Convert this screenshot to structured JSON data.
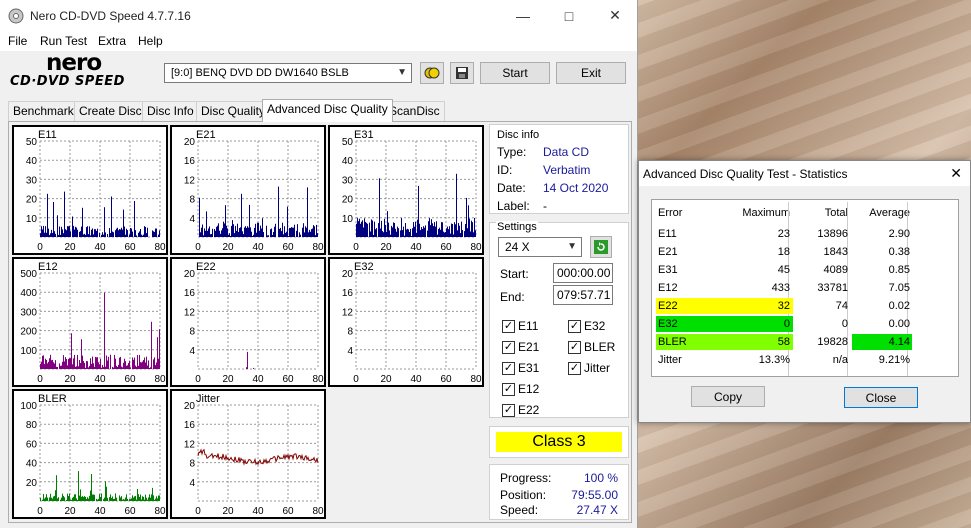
{
  "window": {
    "title": "Nero CD-DVD Speed 4.7.7.16"
  },
  "menu": [
    "File",
    "Run Test",
    "Extra",
    "Help"
  ],
  "logo": {
    "top": "nero",
    "bottom": "CD·DVD SPEED"
  },
  "toolbar": {
    "drive": "[9:0]  BENQ DVD DD DW1640 BSLB",
    "start": "Start",
    "exit": "Exit"
  },
  "tabs": [
    "Benchmark",
    "Create Disc",
    "Disc Info",
    "Disc Quality",
    "Advanced Disc Quality",
    "ScanDisc"
  ],
  "charts": [
    {
      "name": "E11",
      "yticks": [
        "50",
        "40",
        "30",
        "20",
        "10"
      ],
      "xticks": [
        "0",
        "20",
        "40",
        "60",
        "80"
      ],
      "color": "#000080"
    },
    {
      "name": "E21",
      "yticks": [
        "20",
        "16",
        "12",
        "8",
        "4"
      ],
      "xticks": [
        "0",
        "20",
        "40",
        "60",
        "80"
      ],
      "color": "#000080"
    },
    {
      "name": "E31",
      "yticks": [
        "50",
        "40",
        "30",
        "20",
        "10"
      ],
      "xticks": [
        "0",
        "20",
        "40",
        "60",
        "80"
      ],
      "color": "#000080"
    },
    {
      "name": "E12",
      "yticks": [
        "500",
        "400",
        "300",
        "200",
        "100"
      ],
      "xticks": [
        "0",
        "20",
        "40",
        "60",
        "80"
      ],
      "color": "#800080"
    },
    {
      "name": "E22",
      "yticks": [
        "20",
        "16",
        "12",
        "8",
        "4"
      ],
      "xticks": [
        "0",
        "20",
        "40",
        "60",
        "80"
      ],
      "color": "#800080"
    },
    {
      "name": "E32",
      "yticks": [
        "20",
        "16",
        "12",
        "8",
        "4"
      ],
      "xticks": [
        "0",
        "20",
        "40",
        "60",
        "80"
      ],
      "color": "#800080"
    },
    {
      "name": "BLER",
      "yticks": [
        "100",
        "80",
        "60",
        "40",
        "20"
      ],
      "xticks": [
        "0",
        "20",
        "40",
        "60",
        "80"
      ],
      "color": "#008000"
    },
    {
      "name": "Jitter",
      "yticks": [
        "20",
        "16",
        "12",
        "8",
        "4"
      ],
      "xticks": [
        "0",
        "20",
        "40",
        "60",
        "80"
      ],
      "color": "#800000"
    }
  ],
  "disc_info": {
    "title": "Disc info",
    "type_label": "Type:",
    "type": "Data CD",
    "id_label": "ID:",
    "id": "Verbatim",
    "date_label": "Date:",
    "date": "14 Oct 2020",
    "label_label": "Label:",
    "label": "-"
  },
  "settings": {
    "title": "Settings",
    "speed": "24 X",
    "start_label": "Start:",
    "start": "000:00.00",
    "end_label": "End:",
    "end": "079:57.71"
  },
  "checks": [
    {
      "label": "E11",
      "checked": true
    },
    {
      "label": "E32",
      "checked": true
    },
    {
      "label": "E21",
      "checked": true
    },
    {
      "label": "BLER",
      "checked": true
    },
    {
      "label": "E31",
      "checked": true
    },
    {
      "label": "Jitter",
      "checked": true
    },
    {
      "label": "E12",
      "checked": true
    },
    {
      "label": "E22",
      "checked": true
    }
  ],
  "class_label": "Class 3",
  "progress": {
    "progress_label": "Progress:",
    "progress": "100 %",
    "position_label": "Position:",
    "position": "79:55.00",
    "speed_label": "Speed:",
    "speed": "27.47 X"
  },
  "dialog": {
    "title": "Advanced Disc Quality Test - Statistics",
    "close": "✕",
    "headers": [
      "Error",
      "Maximum",
      "Total",
      "Average"
    ],
    "rows": [
      {
        "error": "E11",
        "max": "23",
        "total": "13896",
        "avg": "2.90"
      },
      {
        "error": "E21",
        "max": "18",
        "total": "1843",
        "avg": "0.38"
      },
      {
        "error": "E31",
        "max": "45",
        "total": "4089",
        "avg": "0.85"
      },
      {
        "error": "E12",
        "max": "433",
        "total": "33781",
        "avg": "7.05"
      },
      {
        "error": "E22",
        "max": "32",
        "total": "74",
        "avg": "0.02"
      },
      {
        "error": "E32",
        "max": "0",
        "total": "0",
        "avg": "0.00"
      },
      {
        "error": "BLER",
        "max": "58",
        "total": "19828",
        "avg": "4.14"
      },
      {
        "error": "Jitter",
        "max": "13.3%",
        "total": "n/a",
        "avg": "9.21%"
      }
    ],
    "copy": "Copy",
    "close_btn": "Close"
  },
  "colors": {
    "yellow": "#ffff00",
    "green": "#00e000",
    "lime": "#80ff00",
    "class_bg": "#ffff00"
  }
}
